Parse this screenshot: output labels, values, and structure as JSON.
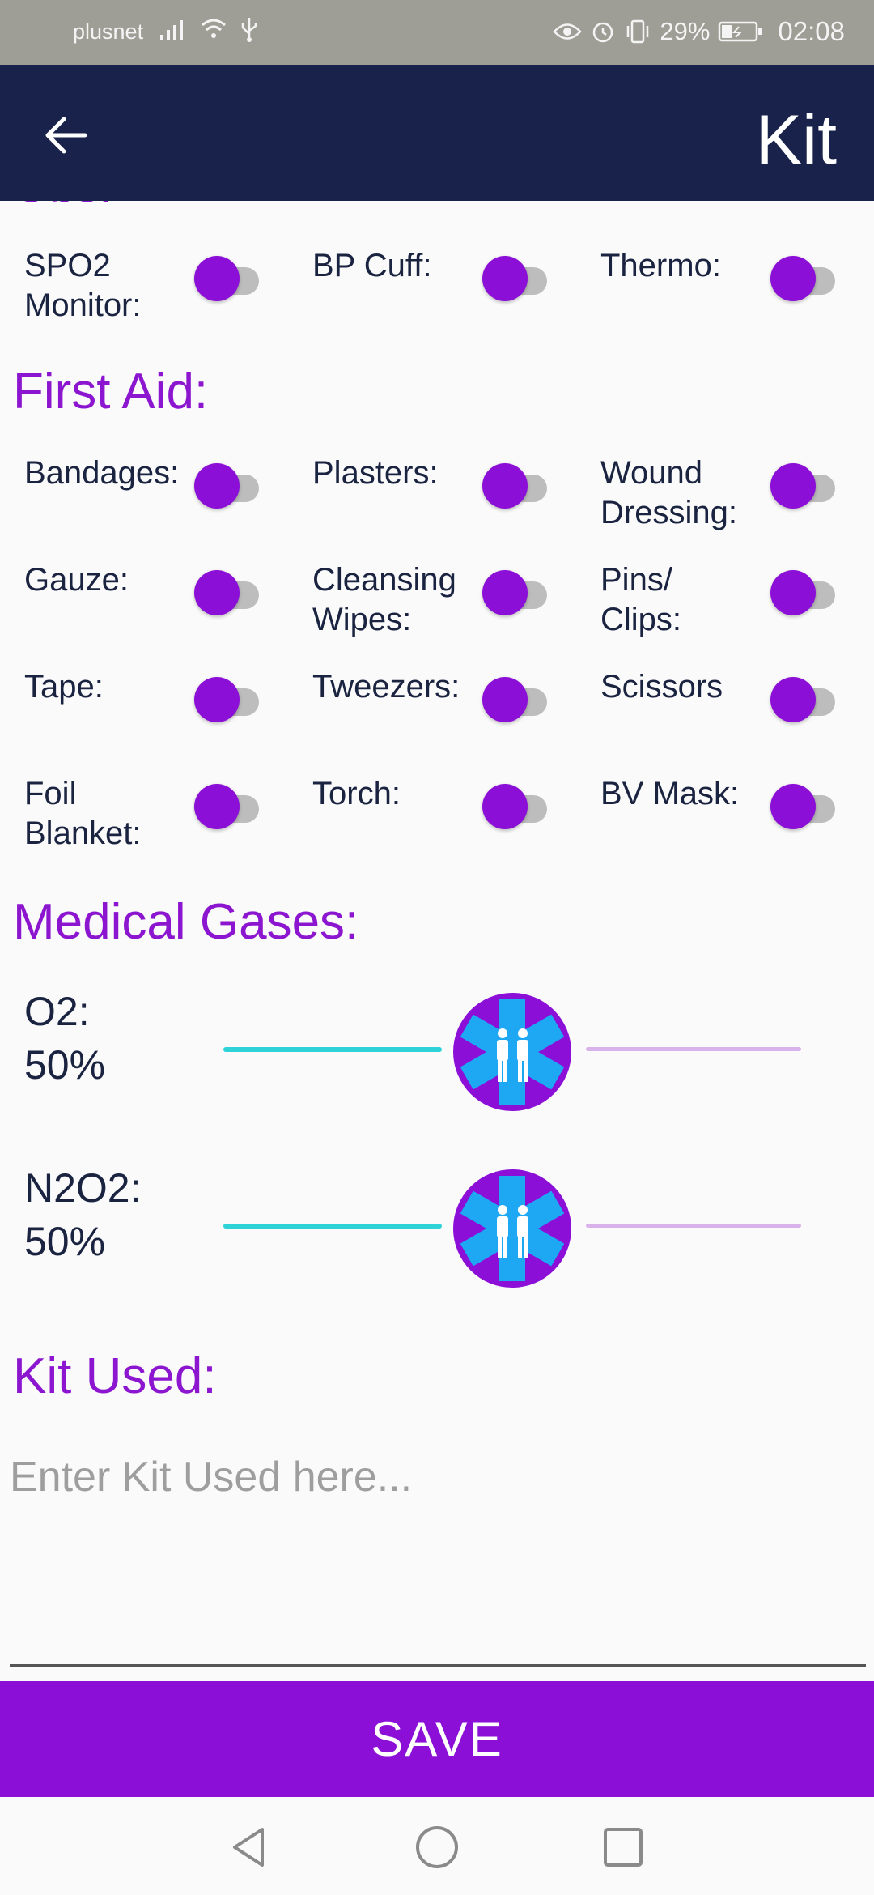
{
  "status_bar": {
    "carrier": "plusnet",
    "battery": "29%",
    "time": "02:08",
    "icons": [
      "signal-icon",
      "wifi-icon",
      "usb-icon",
      "eye-icon",
      "alarm-icon",
      "vibrate-icon",
      "battery-icon"
    ]
  },
  "app_bar": {
    "title": "Kit",
    "back_icon": "back-arrow-icon",
    "background": "#18224a"
  },
  "colors": {
    "accent": "#8c0fd8",
    "heading": "#8c16cf",
    "slider_active": "#2ed3d8",
    "slider_inactive": "#d9b2ec"
  },
  "obs": {
    "items": [
      {
        "label": "SPO2\nMonitor:",
        "on": false
      },
      {
        "label": "BP Cuff:",
        "on": false
      },
      {
        "label": "Thermo:",
        "on": false
      }
    ]
  },
  "first_aid": {
    "heading": "First Aid:",
    "items": [
      {
        "label": "Bandages:",
        "on": false
      },
      {
        "label": "Plasters:",
        "on": false
      },
      {
        "label": "Wound\nDressing:",
        "on": false
      },
      {
        "label": "Gauze:",
        "on": false
      },
      {
        "label": "Cleansing\nWipes:",
        "on": false
      },
      {
        "label": "Pins/\nClips:",
        "on": false
      },
      {
        "label": "Tape:",
        "on": false
      },
      {
        "label": "Tweezers:",
        "on": false
      },
      {
        "label": "Scissors",
        "on": false
      },
      {
        "label": "Foil\nBlanket:",
        "on": false
      },
      {
        "label": "Torch:",
        "on": false
      },
      {
        "label": "BV Mask:",
        "on": false
      }
    ]
  },
  "medical_gases": {
    "heading": "Medical Gases:",
    "gases": [
      {
        "label": "O2:\n50%",
        "value": 0.5,
        "thumb_icon": "star-of-life-paramedics-icon"
      },
      {
        "label": "N2O2:\n50%",
        "value": 0.5,
        "thumb_icon": "star-of-life-paramedics-icon"
      }
    ]
  },
  "kit_used": {
    "heading": "Kit Used:",
    "placeholder": "Enter Kit Used here...",
    "value": ""
  },
  "save_label": "SAVE",
  "nav_bar": {
    "buttons": [
      "back-triangle-icon",
      "home-circle-icon",
      "recents-square-icon"
    ]
  }
}
